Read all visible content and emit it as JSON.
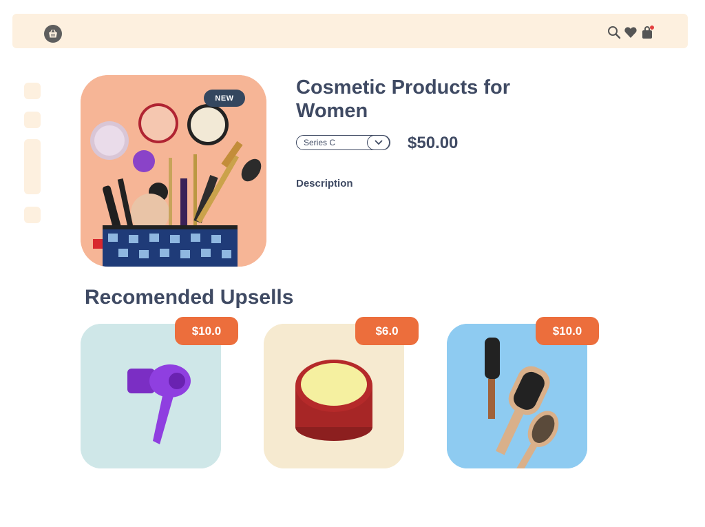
{
  "header": {
    "logo_icon": "basket-icon",
    "icons": [
      "search-icon",
      "heart-icon",
      "cart-icon"
    ]
  },
  "product": {
    "badge": "NEW",
    "title": "Cosmetic Products for Women",
    "variant_selected": "Series C",
    "price": "$50.00",
    "description_label": "Description",
    "image_icon": "cosmetics-bag-image"
  },
  "upsells": {
    "title": "Recomended Upsells",
    "items": [
      {
        "price": "$10.0",
        "image": "hair-dryer-image",
        "bg": "#cfe7e8"
      },
      {
        "price": "$6.0",
        "image": "cream-jar-image",
        "bg": "#f6ead0"
      },
      {
        "price": "$10.0",
        "image": "hair-brushes-image",
        "bg": "#8ecbf1"
      }
    ]
  },
  "colors": {
    "accent": "#ec6e3c",
    "text": "#3f4a63",
    "topbar": "#fdf0df",
    "badge": "#34475f"
  }
}
